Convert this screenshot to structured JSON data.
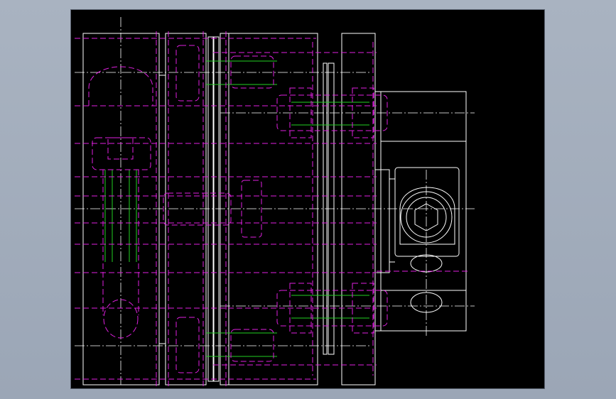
{
  "window": {
    "background_color": "#a9b3c1",
    "viewport_color": "#000000"
  },
  "drawing": {
    "type": "cad-assembly-drawing",
    "layers": [
      {
        "name": "visible-edges",
        "color": "#ffffff"
      },
      {
        "name": "hidden-edges",
        "color": "#e020e0"
      },
      {
        "name": "thread-lines",
        "color": "#22d022"
      },
      {
        "name": "center-lines",
        "color": "#ffffff"
      }
    ]
  }
}
